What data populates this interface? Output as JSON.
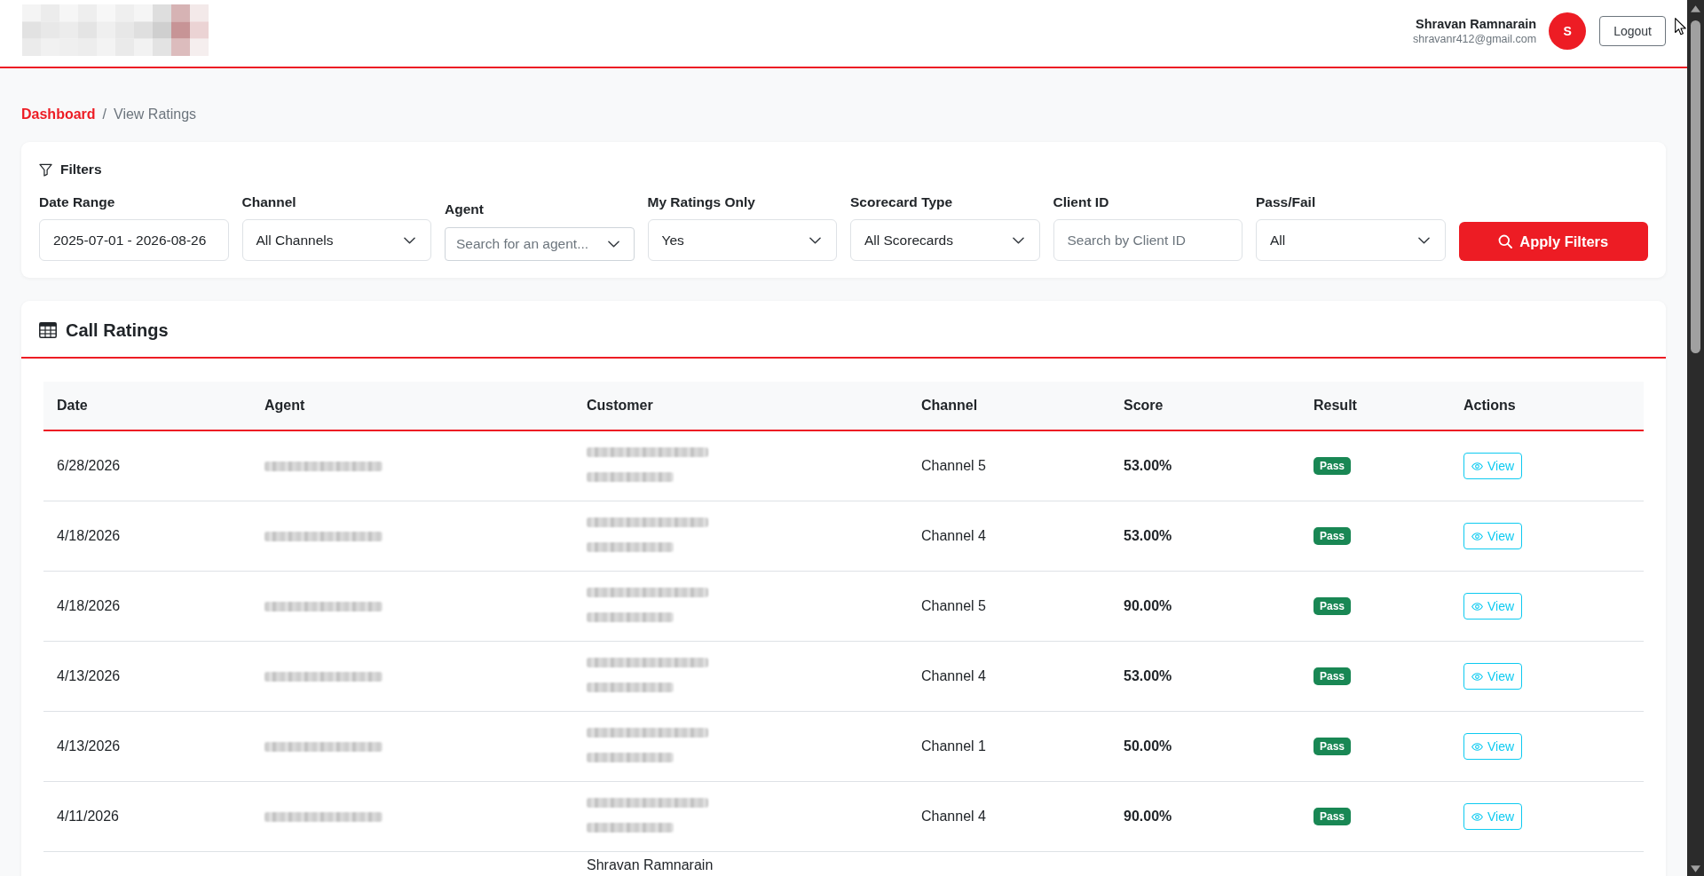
{
  "header": {
    "user": {
      "name": "Shravan Ramnarain",
      "email": "shravanr412@gmail.com",
      "initial": "S"
    },
    "logout": "Logout"
  },
  "breadcrumb": {
    "separator": "/",
    "items": [
      {
        "label": "Dashboard",
        "current": false
      },
      {
        "label": "View Ratings",
        "current": true
      }
    ]
  },
  "filters": {
    "title": "Filters",
    "fields": [
      {
        "kind": "text",
        "label": "Date Range",
        "value": "2025-07-01 - 2026-08-26"
      },
      {
        "kind": "select",
        "label": "Channel",
        "value": "All Channels"
      },
      {
        "kind": "combo",
        "label": "Agent",
        "placeholder": "Search for an agent..."
      },
      {
        "kind": "select",
        "label": "My Ratings Only",
        "value": "Yes"
      },
      {
        "kind": "select",
        "label": "Scorecard Type",
        "value": "All Scorecards"
      },
      {
        "kind": "text",
        "label": "Client ID",
        "placeholder": "Search by Client ID"
      },
      {
        "kind": "select",
        "label": "Pass/Fail",
        "value": "All"
      }
    ],
    "apply": "Apply Filters"
  },
  "ratings": {
    "title": "Call Ratings",
    "columns": [
      "Date",
      "Agent",
      "Customer",
      "Channel",
      "Score",
      "Result",
      "Actions"
    ],
    "rows": [
      {
        "date": "6/28/2026",
        "agent": {
          "redacted": true
        },
        "customer": {
          "redacted": true
        },
        "channel": "Channel 5",
        "score": "53.00%",
        "result": {
          "label": "Pass",
          "passed": true
        },
        "action": "View"
      },
      {
        "date": "4/18/2026",
        "agent": {
          "redacted": true
        },
        "customer": {
          "redacted": true
        },
        "channel": "Channel 4",
        "score": "53.00%",
        "result": {
          "label": "Pass",
          "passed": true
        },
        "action": "View"
      },
      {
        "date": "4/18/2026",
        "agent": {
          "redacted": true
        },
        "customer": {
          "redacted": true
        },
        "channel": "Channel 5",
        "score": "90.00%",
        "result": {
          "label": "Pass",
          "passed": true
        },
        "action": "View"
      },
      {
        "date": "4/13/2026",
        "agent": {
          "redacted": true
        },
        "customer": {
          "redacted": true
        },
        "channel": "Channel 4",
        "score": "53.00%",
        "result": {
          "label": "Pass",
          "passed": true
        },
        "action": "View"
      },
      {
        "date": "4/13/2026",
        "agent": {
          "redacted": true
        },
        "customer": {
          "redacted": true
        },
        "channel": "Channel 1",
        "score": "50.00%",
        "result": {
          "label": "Pass",
          "passed": true
        },
        "action": "View"
      },
      {
        "date": "4/11/2026",
        "agent": {
          "redacted": true
        },
        "customer": {
          "redacted": true
        },
        "channel": "Channel 4",
        "score": "90.00%",
        "result": {
          "label": "Pass",
          "passed": true
        },
        "action": "View"
      },
      {
        "customer": {
          "redacted": false,
          "name": "Shravan Ramnarain"
        }
      }
    ]
  }
}
